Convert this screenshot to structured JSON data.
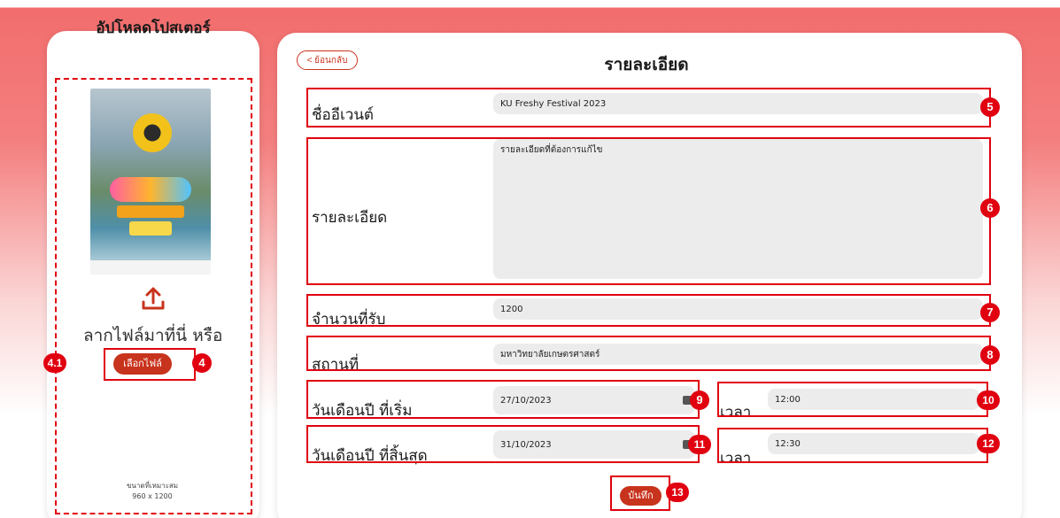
{
  "upload": {
    "title": "อัปโหลดโปสเตอร์",
    "drag_text": "ลากไฟล์มาที่นี่ หรือ",
    "choose_button": "เลือกไฟล์",
    "size_label": "ขนาดที่เหมาะสม",
    "size_value": "960 x 1200"
  },
  "header": {
    "back_button": "< ย้อนกลับ",
    "title": "รายละเอียด"
  },
  "form": {
    "event_name": {
      "label": "ชื่ออีเวนต์",
      "value": "KU Freshy Festival 2023"
    },
    "description": {
      "label": "รายละเอียด",
      "value": "รายละเอียดที่ต้องการแก้ไข"
    },
    "capacity": {
      "label": "จำนวนที่รับ",
      "value": "1200"
    },
    "location": {
      "label": "สถานที่",
      "value": "มหาวิทยาลัยเกษตรศาสตร์"
    },
    "start_date": {
      "label": "วันเดือนปี ที่เริ่ม",
      "value": "27/10/2023"
    },
    "start_time": {
      "label": "เวลา",
      "value": "12:00"
    },
    "end_date": {
      "label": "วันเดือนปี ที่สิ้นสุด",
      "value": "31/10/2023"
    },
    "end_time": {
      "label": "เวลา",
      "value": "12:30"
    },
    "save_button": "บันทึก"
  },
  "annotations": [
    "4.1",
    "4",
    "5",
    "6",
    "7",
    "8",
    "9",
    "10",
    "11",
    "12",
    "13"
  ],
  "colors": {
    "accent": "#c8331d",
    "annotation": "#e0000f",
    "header_gradient": "#f26d6d"
  }
}
